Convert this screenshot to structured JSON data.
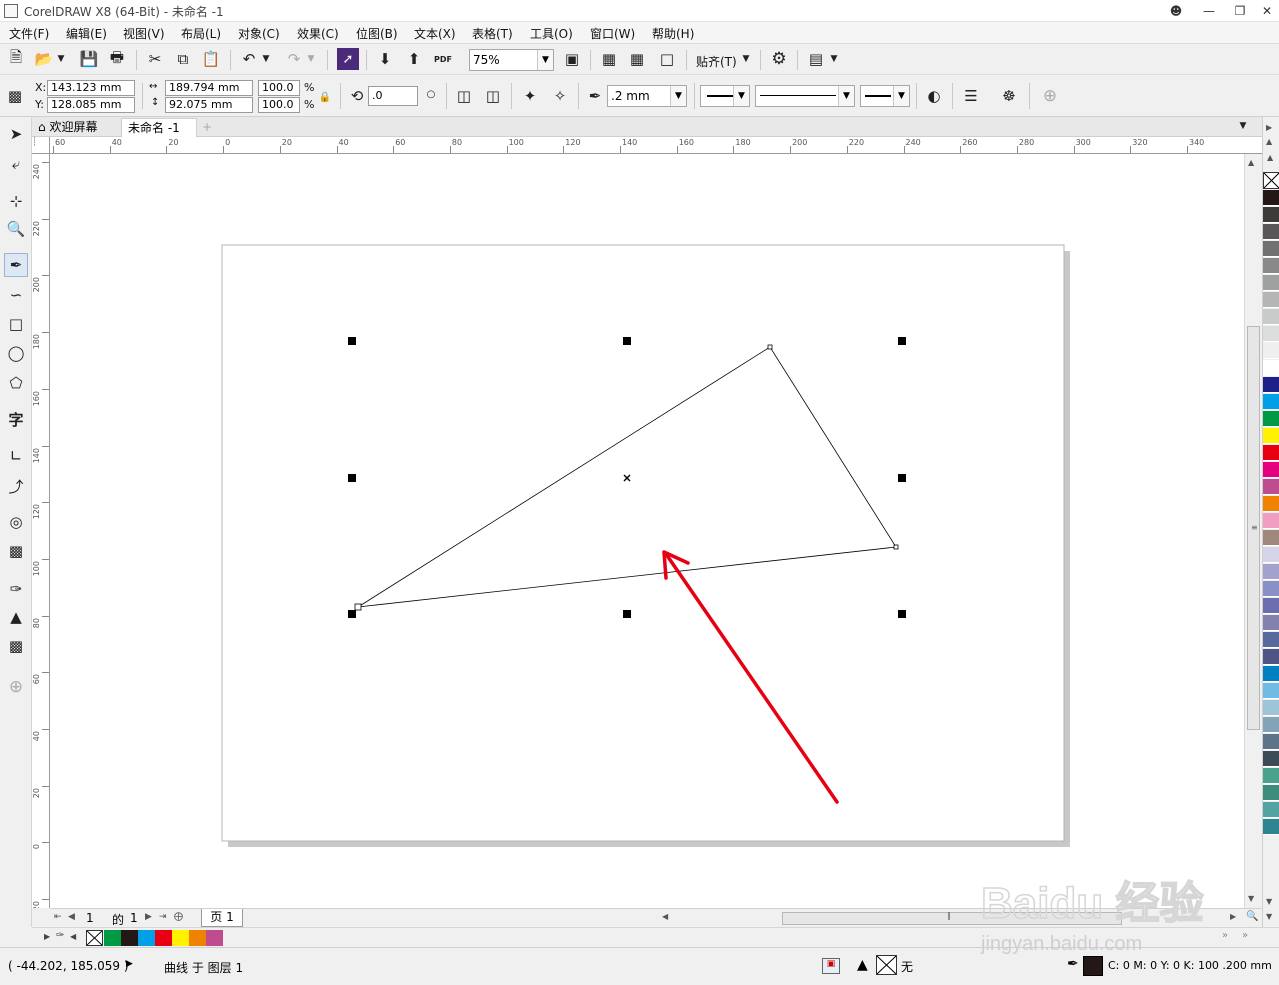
{
  "window": {
    "title": "CorelDRAW X8 (64-Bit) - 未命名 -1"
  },
  "menu": {
    "items": [
      "文件(F)",
      "编辑(E)",
      "视图(V)",
      "布局(L)",
      "对象(C)",
      "效果(C)",
      "位图(B)",
      "文本(X)",
      "表格(T)",
      "工具(O)",
      "窗口(W)",
      "帮助(H)"
    ]
  },
  "toolbar": {
    "zoom_value": "75%",
    "snap_label": "贴齐(T)",
    "pdf_label": "PDF"
  },
  "property_bar": {
    "x_label": "X:",
    "x_value": "143.123 mm",
    "y_label": "Y:",
    "y_value": "128.085 mm",
    "width_value": "189.794 mm",
    "height_value": "92.075 mm",
    "scale_w": "100.0",
    "scale_h": "100.0",
    "percent": "%",
    "rotation_value": ".0",
    "outline_width": ".2 mm"
  },
  "tabs": {
    "welcome": "欢迎屏幕",
    "document": "未命名 -1",
    "add": "+"
  },
  "ruler": {
    "unit": "毫米",
    "h_ticks": [
      "60",
      "40",
      "20",
      "0",
      "20",
      "40",
      "60",
      "80",
      "100",
      "120",
      "140",
      "160",
      "180",
      "200",
      "220",
      "240",
      "260",
      "280",
      "300",
      "320",
      "340"
    ],
    "v_ticks": [
      "240",
      "220",
      "200",
      "180",
      "160",
      "140",
      "120",
      "100",
      "80",
      "60",
      "40",
      "20",
      "0",
      "20"
    ]
  },
  "page_nav": {
    "current": "1",
    "of_label": "的",
    "total": "1",
    "page_tab": "页 1"
  },
  "status": {
    "coords": "( -44.202, 185.059 )",
    "object_info": "曲线 于 图层 1",
    "fill_none": "无",
    "color_info": "C: 0 M: 0 Y: 0 K: 100  .200 mm"
  },
  "palette_colors": [
    "#231815",
    "#3e3a39",
    "#595757",
    "#727171",
    "#898989",
    "#9fa0a0",
    "#b5b5b6",
    "#c9caca",
    "#dcdddd",
    "#efefef",
    "#ffffff",
    "#1d2088",
    "#00a0e9",
    "#009944",
    "#fff100",
    "#e60012",
    "#e4007f",
    "#be4c8f",
    "#ef8200",
    "#f19ec2",
    "#a0877c",
    "#d6d4e8",
    "#a3a2cf",
    "#8890c6",
    "#6b6faf",
    "#8581ad",
    "#576a9e",
    "#4e5584",
    "#0080c0",
    "#6fbbe3",
    "#9ec4d8",
    "#83a3b9",
    "#5d7387",
    "#3c4b58",
    "#49a38c",
    "#3b8c7a",
    "#53a3a3",
    "#2d8590"
  ],
  "doc_palette_colors": [
    "#009944",
    "#231815",
    "#00a0e9",
    "#e60012",
    "#fff100",
    "#ef8200",
    "#be4c8f"
  ],
  "annotation": {
    "arrow_color": "#e60012"
  },
  "watermark": {
    "brand": "Baidu 经验",
    "url": "jingyan.baidu.com"
  }
}
